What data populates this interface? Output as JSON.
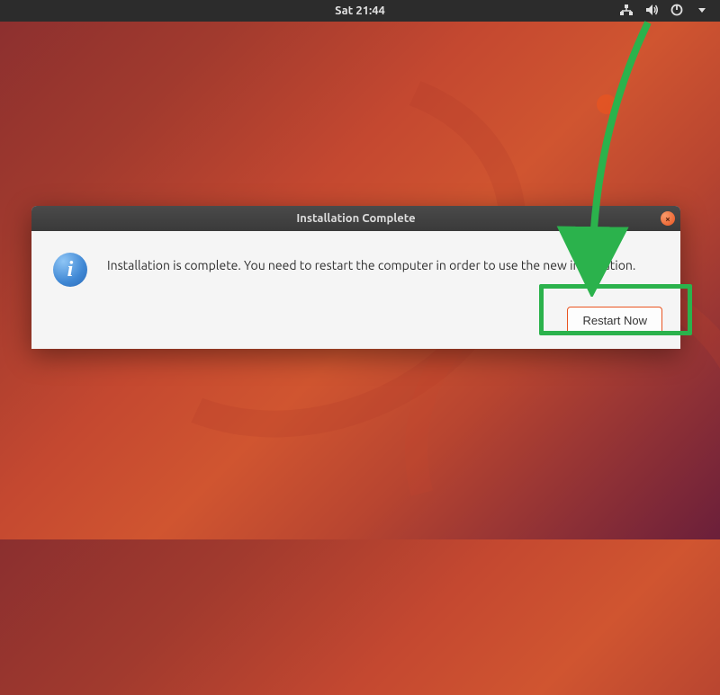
{
  "topbar": {
    "clock": "Sat 21:44"
  },
  "dialog": {
    "title": "Installation Complete",
    "message": "Installation is complete. You need to restart the computer in order to use the new installation.",
    "restart_button": "Restart Now",
    "close_label": "×"
  }
}
